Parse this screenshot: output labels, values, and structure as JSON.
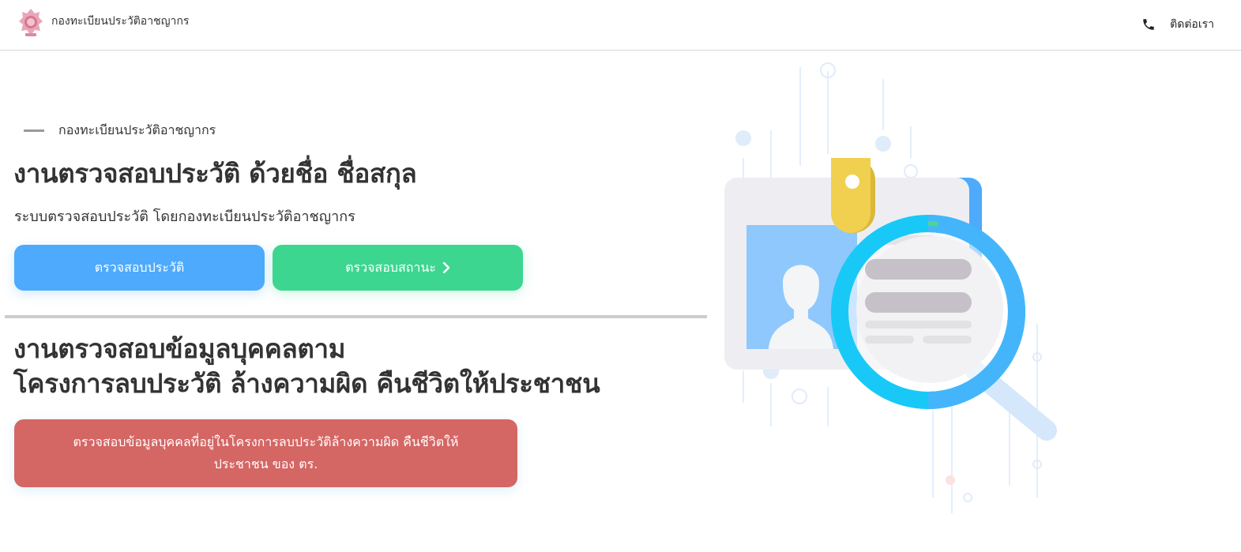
{
  "navbar": {
    "brand_name": "กองทะเบียนประวัติอาชญากร",
    "contact_label": "ติดต่อเรา"
  },
  "hero": {
    "eyebrow": "กองทะเบียนประวัติอาชญากร",
    "title": "งานตรวจสอบประวัติ ด้วยชื่อ ชื่อสกุล",
    "subtitle": "ระบบตรวจสอบประวัติ โดยกองทะเบียนประวัติอาชญากร",
    "buttons": {
      "check_history": "ตรวจสอบประวัติ",
      "check_status": "ตรวจสอบสถานะ"
    }
  },
  "section2": {
    "title_line1": "งานตรวจสอบข้อมูลบุคคลตาม",
    "title_line2": "โครงการลบประวัติ ล้างความผิด คืนชีวิตให้ประชาชน",
    "button_line1": "ตรวจสอบข้อมูลบุคคลที่อยู่ในโครงการลบประวัติล้างความผิด คืนชีวิตให้",
    "button_line2": "ประชาชน ของ ตร."
  },
  "colors": {
    "primary_blue": "#4daafc",
    "success_green": "#3cd690",
    "danger_red": "#d46664",
    "text_dark": "#333333"
  },
  "icons": {
    "brand": "police-emblem-icon",
    "contact": "phone-icon",
    "chevron": "chevron-right-icon",
    "illustration": "id-card-magnifier-illustration"
  }
}
